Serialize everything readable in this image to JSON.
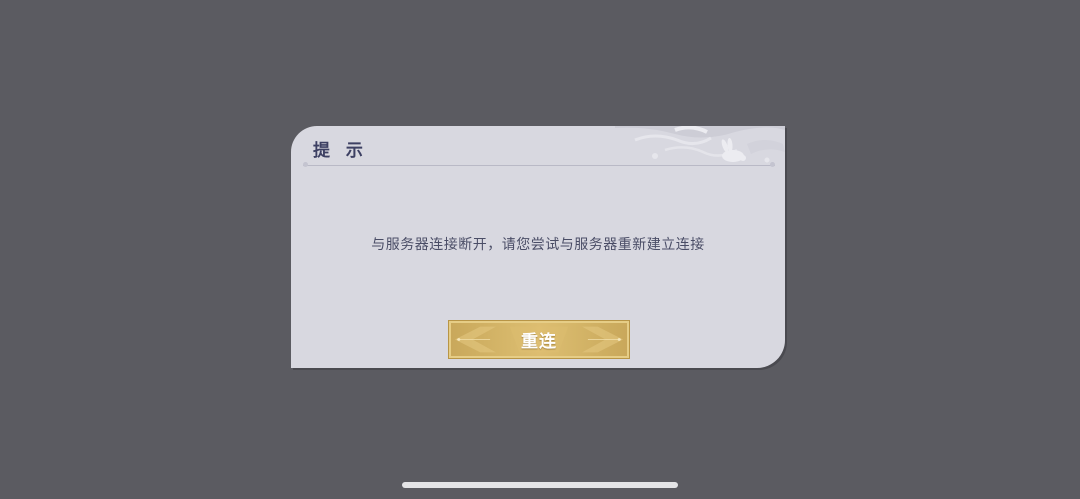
{
  "dialog": {
    "title": "提 示",
    "message": "与服务器连接断开，请您尝试与服务器重新建立连接",
    "button_label": "重连"
  },
  "colors": {
    "backdrop": "#5b5b61",
    "dialog_bg": "#d8d8e0",
    "title": "#3d4063",
    "button_gold": "#d7b86b"
  },
  "icons": {
    "corner_ornament": "rabbit-cloud-ornament-icon",
    "button_decoration": "gold-chevron-ornament-icon"
  }
}
